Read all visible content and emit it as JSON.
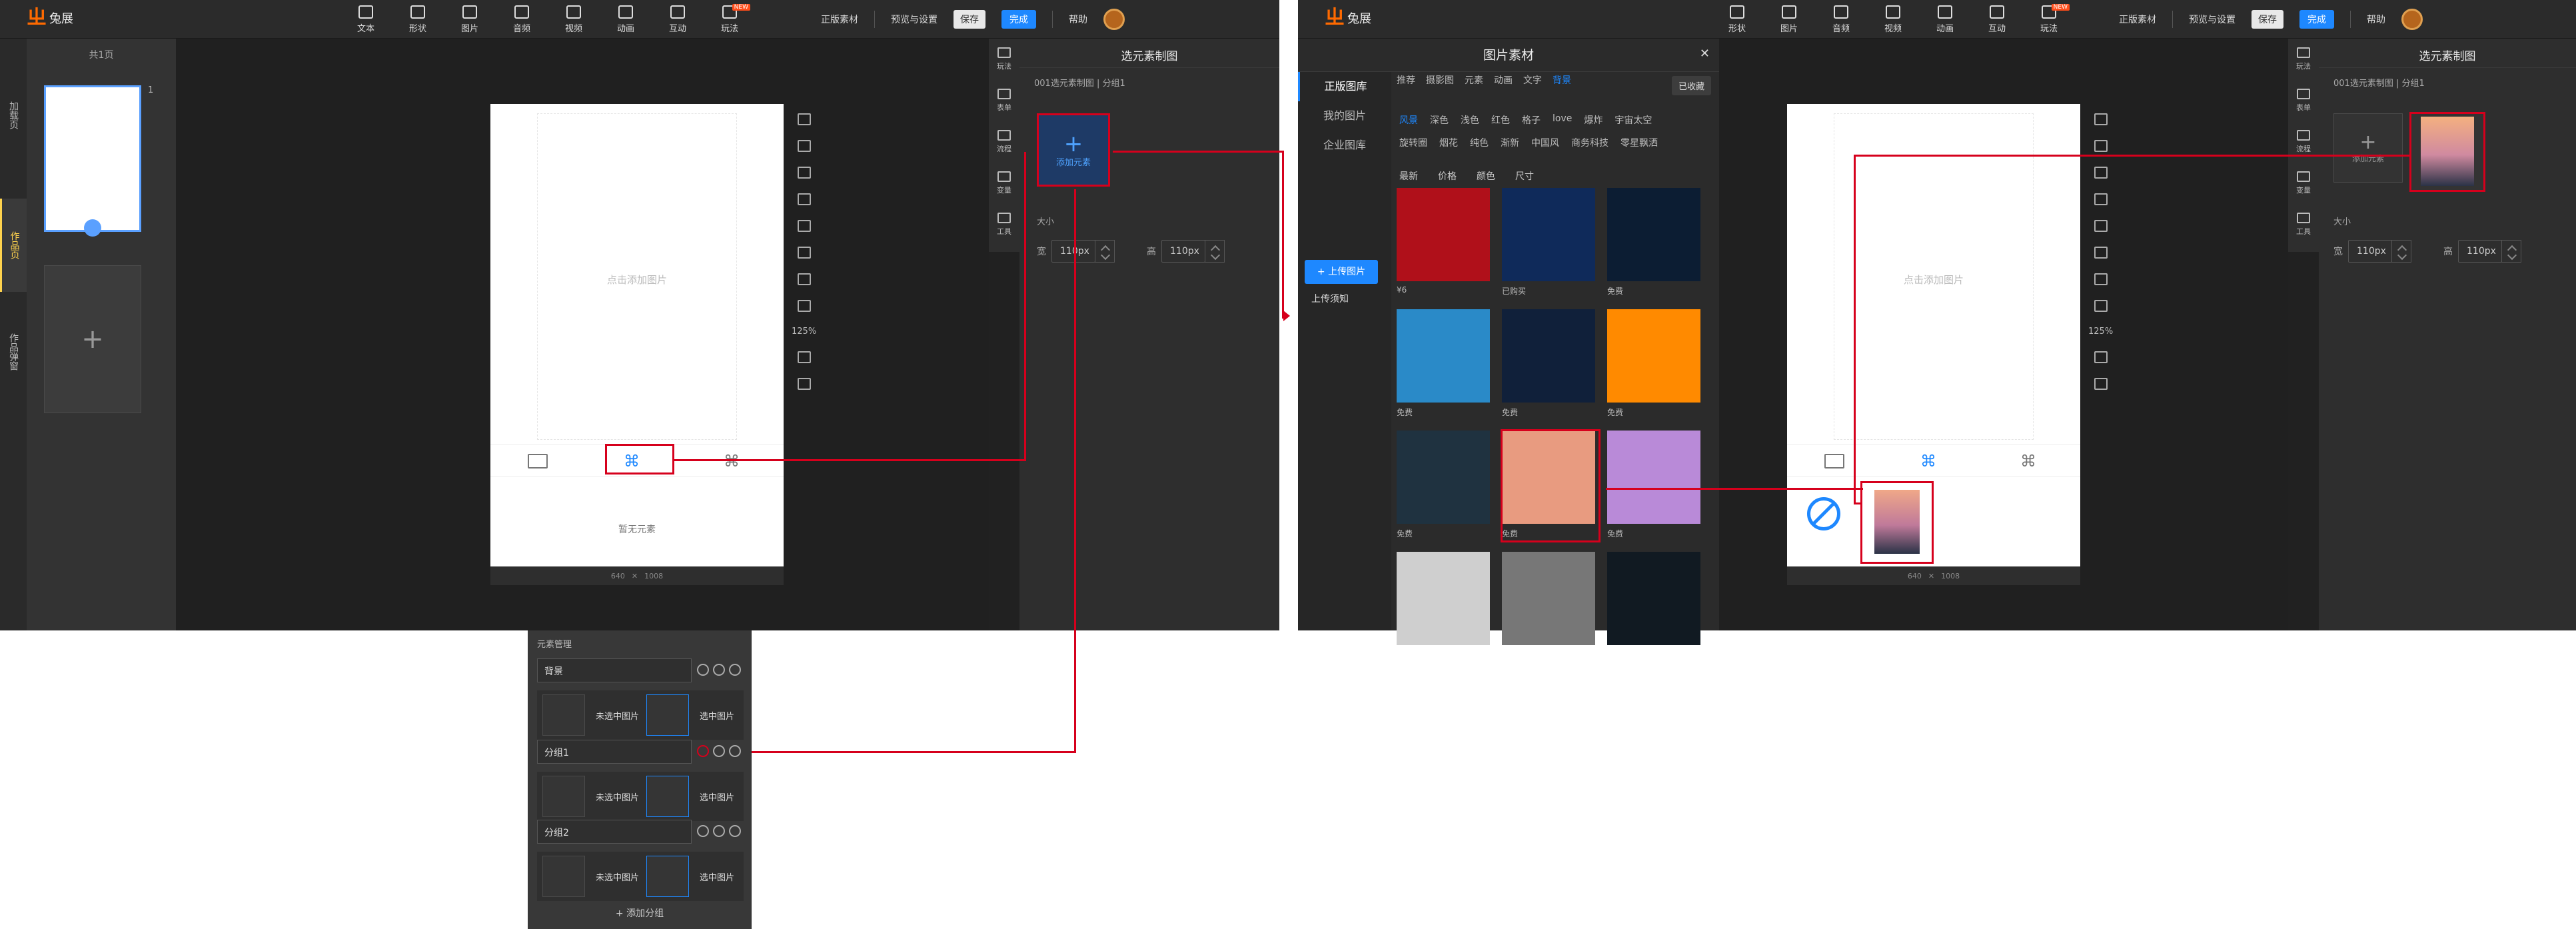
{
  "app": {
    "name": "兔展"
  },
  "toolbar": {
    "tools": [
      {
        "label": "文本",
        "icon": "text-icon"
      },
      {
        "label": "形状",
        "icon": "shape-icon"
      },
      {
        "label": "图片",
        "icon": "image-icon"
      },
      {
        "label": "音频",
        "icon": "audio-icon"
      },
      {
        "label": "视频",
        "icon": "video-icon"
      },
      {
        "label": "动画",
        "icon": "animation-icon"
      },
      {
        "label": "互动",
        "icon": "interaction-icon"
      },
      {
        "label": "玩法",
        "icon": "play-icon",
        "badge": "NEW"
      }
    ],
    "genuine": "正版素材",
    "preview": "预览与设置",
    "save": "保存",
    "done": "完成",
    "help": "帮助"
  },
  "left_tabs": [
    "加载页",
    "作品页",
    "作品弹窗"
  ],
  "pages": {
    "count_label": "共1页",
    "page_no": "1"
  },
  "canvas": {
    "placeholder": "点击添加图片",
    "empty_elements": "暂无元素",
    "zoom": "125%",
    "width_value": "640",
    "height_value": "1008"
  },
  "rightbar": [
    "玩法",
    "表单",
    "流程",
    "变量",
    "工具"
  ],
  "prop_panel": {
    "title": "选元素制图",
    "breadcrumb": "001选元素制图 | 分组1",
    "add_element": "添加元素",
    "size_label": "大小",
    "width_label": "宽",
    "height_label": "高",
    "width_value": "110px",
    "height_value": "110px"
  },
  "manager": {
    "title": "元素管理",
    "groups": [
      {
        "name": "背景",
        "unselected": "未选中图片",
        "selected": "选中图片"
      },
      {
        "name": "分组1",
        "unselected": "未选中图片",
        "selected": "选中图片"
      },
      {
        "name": "分组2",
        "unselected": "未选中图片",
        "selected": "选中图片"
      }
    ],
    "add_group": "+ 添加分组"
  },
  "library": {
    "title": "图片素材",
    "nav": [
      "正版图库",
      "我的图片",
      "企业图库"
    ],
    "upload": "+ 上传图片",
    "upload_note": "上传须知",
    "categories": [
      "推荐",
      "摄影图",
      "元素",
      "动画",
      "文字",
      "背景"
    ],
    "favorites": "已收藏",
    "tags_row1": [
      "风景",
      "深色",
      "浅色",
      "红色",
      "格子",
      "love",
      "爆炸",
      "宇宙太空"
    ],
    "tags_row2": [
      "旋转圈",
      "烟花",
      "纯色",
      "渐新",
      "中国风",
      "商务科技",
      "零星飘洒"
    ],
    "filters": [
      "最新",
      "价格",
      "颜色",
      "尺寸"
    ],
    "items": [
      {
        "label": "¥6",
        "color": "#b0101a"
      },
      {
        "label": "已购买",
        "color": "#0f2a5a"
      },
      {
        "label": "免费",
        "color": "#0c1d33"
      },
      {
        "label": "免费",
        "color": "#2a8ac8"
      },
      {
        "label": "免费",
        "color": "#10203a"
      },
      {
        "label": "免费",
        "color": "#ff8a00"
      },
      {
        "label": "免费",
        "color": "#1f3240"
      },
      {
        "label": "免费",
        "color": "#e89b80"
      },
      {
        "label": "免费",
        "color": "#b98ad8"
      },
      {
        "label": "",
        "color": "#cfcfcf"
      },
      {
        "label": "",
        "color": "#777"
      },
      {
        "label": "",
        "color": "#111a22"
      }
    ]
  }
}
